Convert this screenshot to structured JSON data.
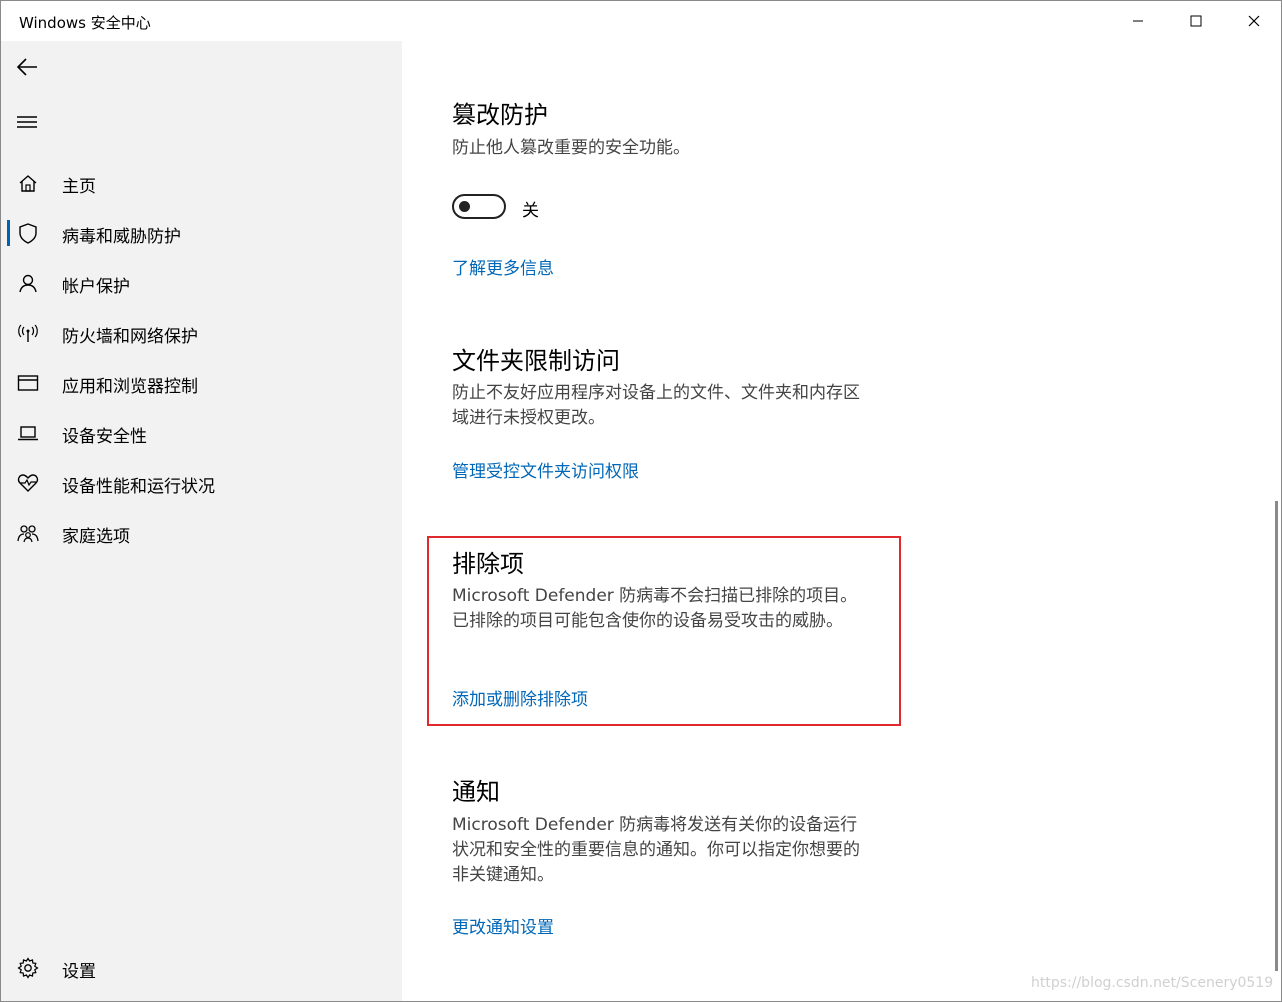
{
  "window": {
    "title": "Windows 安全中心"
  },
  "sidebar": {
    "items": [
      {
        "label": "主页",
        "icon": "home-icon"
      },
      {
        "label": "病毒和威胁防护",
        "icon": "shield-icon",
        "active": true
      },
      {
        "label": "帐户保护",
        "icon": "person-icon"
      },
      {
        "label": "防火墙和网络保护",
        "icon": "wifi-antenna-icon"
      },
      {
        "label": "应用和浏览器控制",
        "icon": "app-window-icon"
      },
      {
        "label": "设备安全性",
        "icon": "laptop-icon"
      },
      {
        "label": "设备性能和运行状况",
        "icon": "heart-pulse-icon"
      },
      {
        "label": "家庭选项",
        "icon": "family-icon"
      }
    ],
    "settings_label": "设置"
  },
  "tamper": {
    "title": "篡改防护",
    "desc": "防止他人篡改重要的安全功能。",
    "toggle_state": "关",
    "toggle_on": false,
    "link": "了解更多信息"
  },
  "folder_access": {
    "title": "文件夹限制访问",
    "desc": "防止不友好应用程序对设备上的文件、文件夹和内存区域进行未授权更改。",
    "link": "管理受控文件夹访问权限"
  },
  "exclusions": {
    "title": "排除项",
    "desc": "Microsoft Defender 防病毒不会扫描已排除的项目。已排除的项目可能包含使你的设备易受攻击的威胁。",
    "link": "添加或删除排除项"
  },
  "notifications": {
    "title": "通知",
    "desc": "Microsoft Defender 防病毒将发送有关你的设备运行状况和安全性的重要信息的通知。你可以指定你想要的非关键通知。",
    "link": "更改通知设置"
  },
  "watermark": "https://blog.csdn.net/Scenery0519",
  "colors": {
    "accent": "#0067b8",
    "active_indicator": "#0063b1",
    "highlight_box": "#e0292d",
    "sidebar_bg": "#f2f2f2"
  }
}
